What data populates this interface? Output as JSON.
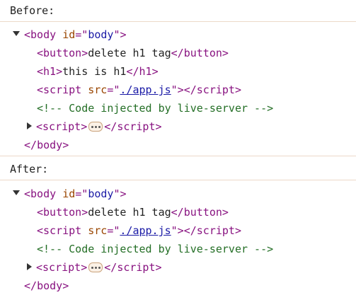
{
  "before": {
    "label": "Before:",
    "body_open": {
      "tag": "body",
      "attr_name": "id",
      "attr_value": "body"
    },
    "button_text": "delete h1 tag",
    "h1_text": "this is h1",
    "script_src": "./app.js",
    "comment": "<!-- Code injected by live-server -->",
    "collapsed_script": "script",
    "body_close": "body"
  },
  "after": {
    "label": "After:",
    "body_open": {
      "tag": "body",
      "attr_name": "id",
      "attr_value": "body"
    },
    "button_text": "delete h1 tag",
    "script_src": "./app.js",
    "comment": "<!-- Code injected by live-server -->",
    "collapsed_script": "script",
    "body_close": "body"
  },
  "tags": {
    "button": "button",
    "h1": "h1",
    "script": "script",
    "src_attr": "src"
  },
  "icons": {
    "expanded": "triangle-down-icon",
    "collapsed": "triangle-right-icon",
    "ellipsis": "ellipsis-icon"
  },
  "colors": {
    "tag": "#881280",
    "attr": "#994500",
    "value": "#1a1aa6",
    "comment": "#236e25",
    "divider": "#ecd9c8"
  }
}
